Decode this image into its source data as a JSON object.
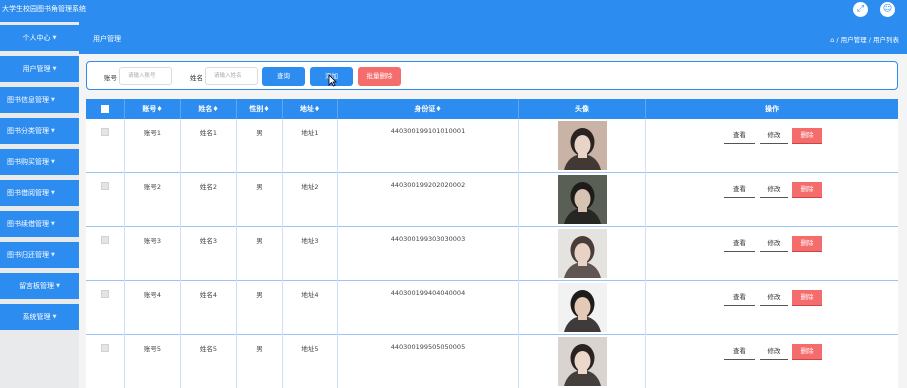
{
  "app": {
    "title": "大学生校园图书角管理系统"
  },
  "topbar": {
    "home_glyph": "⌂",
    "icons": [
      "expand-icon",
      "user-icon"
    ]
  },
  "sidebar": {
    "items": [
      {
        "label": "个人中心",
        "key": "profile"
      },
      {
        "label": "用户管理",
        "key": "users"
      },
      {
        "label": "图书信息管理",
        "key": "book-info"
      },
      {
        "label": "图书分类管理",
        "key": "book-category"
      },
      {
        "label": "图书购买管理",
        "key": "book-purchase"
      },
      {
        "label": "图书借阅管理",
        "key": "book-borrow"
      },
      {
        "label": "图书续借管理",
        "key": "book-renew"
      },
      {
        "label": "图书归还管理",
        "key": "book-return"
      },
      {
        "label": "留言板管理",
        "key": "message-board"
      },
      {
        "label": "系统管理",
        "key": "system"
      }
    ]
  },
  "header": {
    "title": "用户管理",
    "breadcrumb": "/ 用户管理 / 用户列表"
  },
  "search": {
    "account_label": "账号",
    "account_placeholder": "请输入账号",
    "name_label": "姓名",
    "name_placeholder": "请输入姓名",
    "query_button": "查询",
    "add_button": "添加",
    "batch_delete_button": "批量删除"
  },
  "table": {
    "columns": [
      "",
      "账号♦",
      "姓名♦",
      "性别♦",
      "地址♦",
      "身份证♦",
      "头像",
      "操作"
    ],
    "rows": [
      {
        "account": "账号1",
        "name": "姓名1",
        "gender": "男",
        "address": "地址1",
        "id_card": "440300199101010001",
        "avatar_colors": [
          "#c9b3a6",
          "#2b2320",
          "#e9d4c8"
        ]
      },
      {
        "account": "账号2",
        "name": "姓名2",
        "gender": "男",
        "address": "地址2",
        "id_card": "440300199202020002",
        "avatar_colors": [
          "#5a5f55",
          "#1d1c1b",
          "#d6c3b2"
        ]
      },
      {
        "account": "账号3",
        "name": "姓名3",
        "gender": "男",
        "address": "地址3",
        "id_card": "440300199303030003",
        "avatar_colors": [
          "#e5e3e0",
          "#4a3c38",
          "#e8d2c6"
        ]
      },
      {
        "account": "账号4",
        "name": "姓名4",
        "gender": "男",
        "address": "地址4",
        "id_card": "440300199404040004",
        "avatar_colors": [
          "#f2f2f2",
          "#1f1b1a",
          "#e4c9b6"
        ]
      },
      {
        "account": "账号5",
        "name": "姓名5",
        "gender": "男",
        "address": "地址5",
        "id_card": "440300199505050005",
        "avatar_colors": [
          "#d9d4cf",
          "#2a2321",
          "#ecd7cb"
        ]
      }
    ],
    "actions": {
      "view": "查看",
      "edit": "修改",
      "delete": "删除"
    }
  },
  "colors": {
    "primary": "#2d8cf0",
    "danger": "#f56c6c",
    "sidebar_bg": "#e8eaeb"
  }
}
